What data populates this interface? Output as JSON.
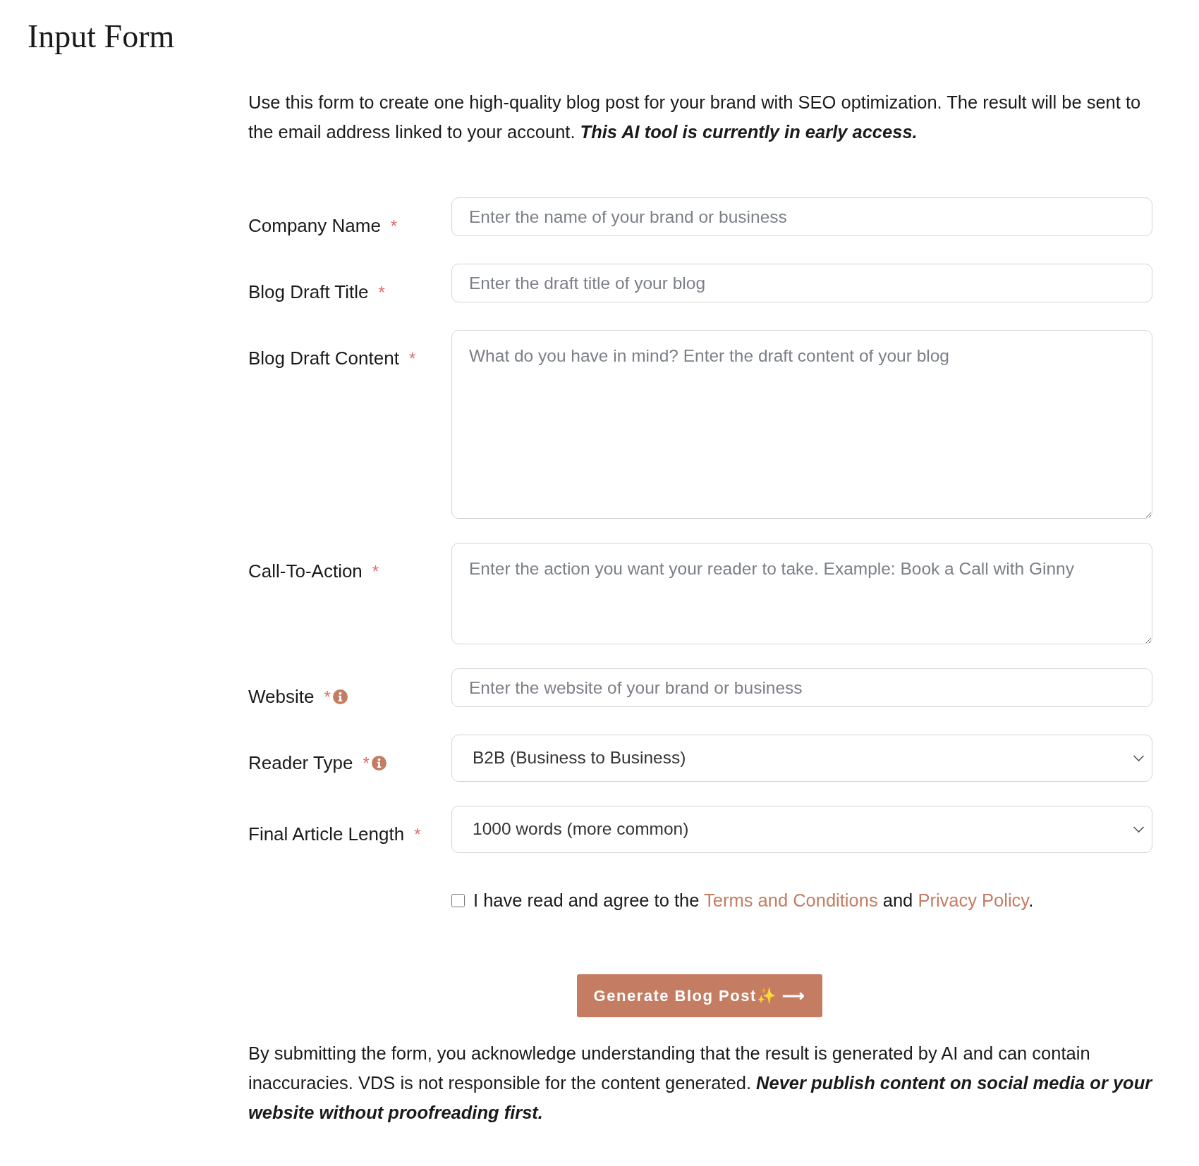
{
  "title": "Input Form",
  "intro": {
    "text": "Use this form to create one high-quality blog post for your brand with SEO optimization. The result will be sent to the email address linked to your account. ",
    "emphasis": "This AI tool is currently in early access."
  },
  "fields": [
    {
      "kind": "input",
      "label": "Company Name",
      "required": true,
      "info": false,
      "placeholder": "Enter the name of your brand or business"
    },
    {
      "kind": "input",
      "label": "Blog Draft Title",
      "required": true,
      "info": false,
      "placeholder": "Enter the draft title of your blog"
    },
    {
      "kind": "textarea",
      "label": "Blog Draft Content",
      "required": true,
      "info": false,
      "placeholder": "What do you have in mind? Enter the draft content of your blog"
    },
    {
      "kind": "textarea_short",
      "label": "Call-To-Action",
      "required": true,
      "info": false,
      "placeholder": "Enter the action you want your reader to take. Example: Book a Call with Ginny"
    },
    {
      "kind": "input",
      "label": "Website",
      "required": true,
      "info": true,
      "placeholder": "Enter the website of your brand or business"
    },
    {
      "kind": "select",
      "label": "Reader Type",
      "required": true,
      "info": true,
      "value": "B2B (Business to Business)"
    },
    {
      "kind": "select",
      "label": "Final Article Length",
      "required": true,
      "info": false,
      "value": "1000 words (more common)"
    }
  ],
  "required_mark": "*",
  "agreement": {
    "checked": false,
    "text_before": "I have read and agree to the ",
    "link_1": "Terms and Conditions",
    "text_middle": " and ",
    "link_2": "Privacy Policy",
    "text_after": "."
  },
  "submit_button": {
    "label": "Generate Blog Post",
    "sparkle": "✨",
    "arrow": "⟶"
  },
  "disclaimer": {
    "text": "By submitting the form, you acknowledge understanding that the result is generated by AI and can contain inaccuracies. VDS is not responsible for the content generated. ",
    "emphasis": "Never publish content on social media or your website without proofreading first."
  }
}
